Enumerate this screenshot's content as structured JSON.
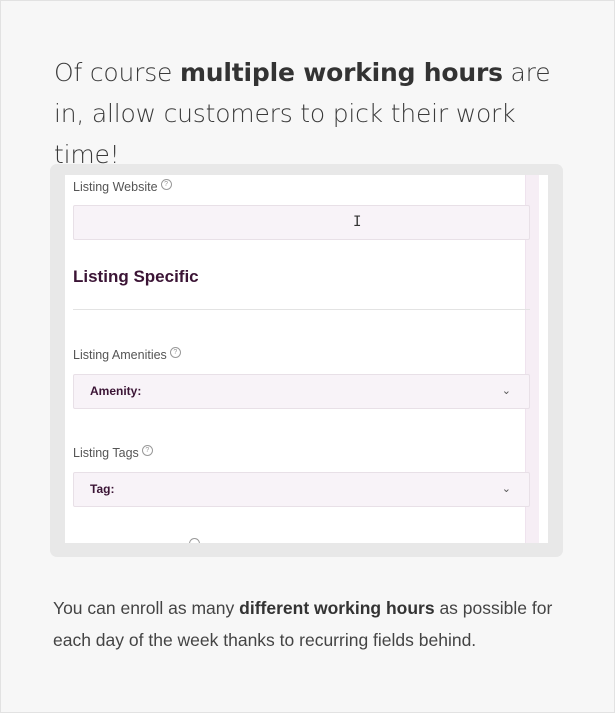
{
  "headline": {
    "part1": "Of course ",
    "bold": "multiple working hours",
    "part2": " are in, allow customers to pick their work time!"
  },
  "form": {
    "website_label": "Listing Website",
    "website_value": "",
    "section_title": "Listing Specific",
    "amenities_label": "Listing Amenities",
    "amenities_value": "Amenity:",
    "tags_label": "Listing Tags",
    "tags_value": "Tag:",
    "help_glyph": "?",
    "chevron_glyph": "⌄",
    "cursor_glyph": "I"
  },
  "body": {
    "part1": "You can enroll as many ",
    "bold": "different working hours",
    "part2": " as possible for each day of the week thanks to recurring fields behind."
  },
  "colors": {
    "accent": "#3b1435",
    "field_bg": "#f8f3f8"
  }
}
